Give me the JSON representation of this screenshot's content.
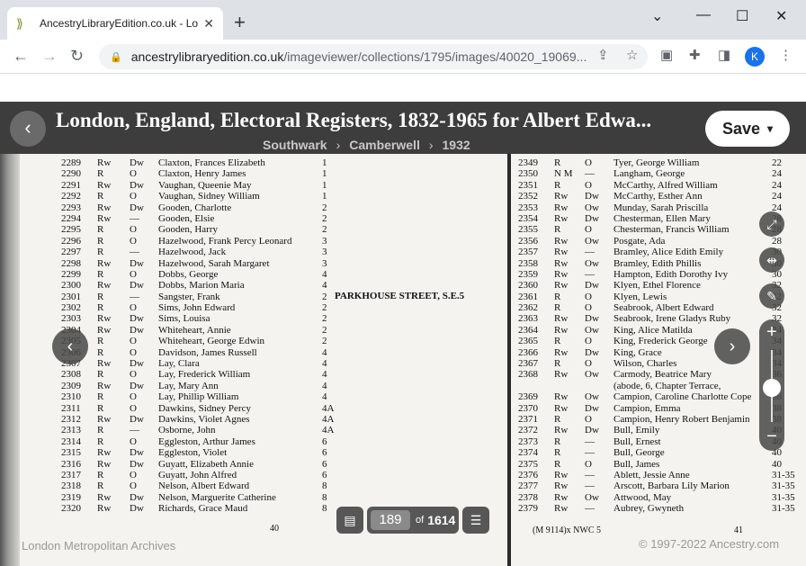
{
  "browser": {
    "tab_title": "AncestryLibraryEdition.co.uk - Lo",
    "url_host": "ancestrylibraryedition.co.uk",
    "url_path": "/imageviewer/collections/1795/images/40020_19069...",
    "profile_initial": "K"
  },
  "viewer": {
    "title": "London, England, Electoral Registers, 1832-1965 for Albert Edwa...",
    "breadcrumb": [
      "Southwark",
      "Camberwell",
      "1932"
    ],
    "save_label": "Save",
    "current_image": "189",
    "of_label": "of",
    "total_images": "1614",
    "footer_left": "London Metropolitan Archives",
    "footer_right": "© 1997-2022 Ancestry.com"
  },
  "document": {
    "street": "PARKHOUSE STREET, S.E.5",
    "left_page_number": "40",
    "right_page_number": "41",
    "right_footer_code": "(M 9114)x  NWC 5",
    "left_rows": [
      {
        "no": "2289",
        "q": "Rw",
        "s": "Dw",
        "name": "Claxton, Frances Elizabeth",
        "addr": "1"
      },
      {
        "no": "2290",
        "q": "R",
        "s": "O",
        "name": "Claxton, Henry James",
        "addr": "1"
      },
      {
        "no": "2291",
        "q": "Rw",
        "s": "Dw",
        "name": "Vaughan, Queenie May",
        "addr": "1"
      },
      {
        "no": "2292",
        "q": "R",
        "s": "O",
        "name": "Vaughan, Sidney William",
        "addr": "1"
      },
      {
        "no": "2293",
        "q": "Rw",
        "s": "Dw",
        "name": "Gooden, Charlotte",
        "addr": "2"
      },
      {
        "no": "2294",
        "q": "Rw",
        "s": "—",
        "name": "Gooden, Elsie",
        "addr": "2"
      },
      {
        "no": "2295",
        "q": "R",
        "s": "O",
        "name": "Gooden, Harry",
        "addr": "2"
      },
      {
        "no": "2296",
        "q": "R",
        "s": "O",
        "name": "Hazelwood, Frank Percy Leonard",
        "addr": "3"
      },
      {
        "no": "2297",
        "q": "R",
        "s": "—",
        "name": "Hazelwood, Jack",
        "addr": "3"
      },
      {
        "no": "2298",
        "q": "Rw",
        "s": "Dw",
        "name": "Hazelwood, Sarah Margaret",
        "addr": "3"
      },
      {
        "no": "2299",
        "q": "R",
        "s": "O",
        "name": "Dobbs, George",
        "addr": "4"
      },
      {
        "no": "2300",
        "q": "Rw",
        "s": "Dw",
        "name": "Dobbs, Marion Maria",
        "addr": "4"
      },
      {
        "no": "2301",
        "q": "R",
        "s": "—",
        "name": "Sangster, Frank",
        "addr": "2"
      },
      {
        "no": "2302",
        "q": "R",
        "s": "O",
        "name": "Sims, John Edward",
        "addr": "2"
      },
      {
        "no": "2303",
        "q": "Rw",
        "s": "Dw",
        "name": "Sims, Louisa",
        "addr": "2"
      },
      {
        "no": "2304",
        "q": "Rw",
        "s": "Dw",
        "name": "Whiteheart, Annie",
        "addr": "2"
      },
      {
        "no": "2305",
        "q": "R",
        "s": "O",
        "name": "Whiteheart, George Edwin",
        "addr": "2"
      },
      {
        "no": "2306",
        "q": "R",
        "s": "O",
        "name": "Davidson, James Russell",
        "addr": "4"
      },
      {
        "no": "2307",
        "q": "Rw",
        "s": "Dw",
        "name": "Lay, Clara",
        "addr": "4"
      },
      {
        "no": "2308",
        "q": "R",
        "s": "O",
        "name": "Lay, Frederick William",
        "addr": "4"
      },
      {
        "no": "2309",
        "q": "Rw",
        "s": "Dw",
        "name": "Lay, Mary Ann",
        "addr": "4"
      },
      {
        "no": "2310",
        "q": "R",
        "s": "O",
        "name": "Lay, Phillip William",
        "addr": "4"
      },
      {
        "no": "2311",
        "q": "R",
        "s": "O",
        "name": "Dawkins, Sidney Percy",
        "addr": "4A"
      },
      {
        "no": "2312",
        "q": "Rw",
        "s": "Dw",
        "name": "Dawkins, Violet Agnes",
        "addr": "4A"
      },
      {
        "no": "2313",
        "q": "R",
        "s": "—",
        "name": "Osborne, John",
        "addr": "4A"
      },
      {
        "no": "2314",
        "q": "R",
        "s": "O",
        "name": "Eggleston, Arthur James",
        "addr": "6"
      },
      {
        "no": "2315",
        "q": "Rw",
        "s": "Dw",
        "name": "Eggleston, Violet",
        "addr": "6"
      },
      {
        "no": "2316",
        "q": "Rw",
        "s": "Dw",
        "name": "Guyatt, Elizabeth Annie",
        "addr": "6"
      },
      {
        "no": "2317",
        "q": "R",
        "s": "O",
        "name": "Guyatt, John Alfred",
        "addr": "6"
      },
      {
        "no": "2318",
        "q": "R",
        "s": "O",
        "name": "Nelson, Albert Edward",
        "addr": "8"
      },
      {
        "no": "2319",
        "q": "Rw",
        "s": "Dw",
        "name": "Nelson, Marguerite Catherine",
        "addr": "8"
      },
      {
        "no": "2320",
        "q": "Rw",
        "s": "Dw",
        "name": "Richards, Grace Maud",
        "addr": "8"
      }
    ],
    "right_rows": [
      {
        "no": "2349",
        "q": "R",
        "s": "O",
        "name": "Tyer, George William",
        "addr": "22"
      },
      {
        "no": "2350",
        "q": "N M",
        "s": "—",
        "name": "Langham, George",
        "addr": "24"
      },
      {
        "no": "2351",
        "q": "R",
        "s": "O",
        "name": "McCarthy, Alfred William",
        "addr": "24"
      },
      {
        "no": "2352",
        "q": "Rw",
        "s": "Dw",
        "name": "McCarthy, Esther Ann",
        "addr": "24"
      },
      {
        "no": "2353",
        "q": "Rw",
        "s": "Ow",
        "name": "Munday, Sarah Priscilla",
        "addr": "24"
      },
      {
        "no": "2354",
        "q": "Rw",
        "s": "Dw",
        "name": "Chesterman, Ellen Mary",
        "addr": "28"
      },
      {
        "no": "2355",
        "q": "R",
        "s": "O",
        "name": "Chesterman, Francis William",
        "addr": "28"
      },
      {
        "no": "2356",
        "q": "Rw",
        "s": "Ow",
        "name": "Posgate, Ada",
        "addr": "28"
      },
      {
        "no": "2357",
        "q": "Rw",
        "s": "—",
        "name": "Bramley, Alice Edith Emily",
        "addr": "30"
      },
      {
        "no": "2358",
        "q": "Rw",
        "s": "Ow",
        "name": "Bramley, Edith Phillis",
        "addr": "30"
      },
      {
        "no": "2359",
        "q": "Rw",
        "s": "—",
        "name": "Hampton, Edith Dorothy Ivy",
        "addr": "30"
      },
      {
        "no": "2360",
        "q": "Rw",
        "s": "Dw",
        "name": "Klyen, Ethel Florence",
        "addr": "32"
      },
      {
        "no": "2361",
        "q": "R",
        "s": "O",
        "name": "Klyen, Lewis",
        "addr": "32"
      },
      {
        "no": "2362",
        "q": "R",
        "s": "O",
        "name": "Seabrook, Albert Edward",
        "addr": "32"
      },
      {
        "no": "2363",
        "q": "Rw",
        "s": "Dw",
        "name": "Seabrook, Irene Gladys Ruby",
        "addr": "32"
      },
      {
        "no": "2364",
        "q": "Rw",
        "s": "Ow",
        "name": "King, Alice Matilda",
        "addr": "34"
      },
      {
        "no": "2365",
        "q": "R",
        "s": "O",
        "name": "King, Frederick George",
        "addr": "34"
      },
      {
        "no": "2366",
        "q": "Rw",
        "s": "Dw",
        "name": "King, Grace",
        "addr": "34"
      },
      {
        "no": "2367",
        "q": "R",
        "s": "O",
        "name": "Wilson, Charles",
        "addr": "34"
      },
      {
        "no": "2368",
        "q": "Rw",
        "s": "Ow",
        "name": "Carmody, Beatrice Mary",
        "addr": "36"
      },
      {
        "no": "",
        "q": "",
        "s": "",
        "name": "(abode, 6, Chapter Terrace,",
        "addr": ""
      },
      {
        "no": "2369",
        "q": "Rw",
        "s": "Ow",
        "name": "Campion, Caroline Charlotte Cope",
        "addr": "38"
      },
      {
        "no": "2370",
        "q": "Rw",
        "s": "Dw",
        "name": "Campion, Emma",
        "addr": "38"
      },
      {
        "no": "2371",
        "q": "R",
        "s": "O",
        "name": "Campion, Henry Robert Benjamin",
        "addr": "38"
      },
      {
        "no": "2372",
        "q": "Rw",
        "s": "Dw",
        "name": "Bull, Emily",
        "addr": "40"
      },
      {
        "no": "2373",
        "q": "R",
        "s": "—",
        "name": "Bull, Ernest",
        "addr": "40"
      },
      {
        "no": "2374",
        "q": "R",
        "s": "—",
        "name": "Bull, George",
        "addr": "40"
      },
      {
        "no": "2375",
        "q": "R",
        "s": "O",
        "name": "Bull, James",
        "addr": "40"
      },
      {
        "no": "2376",
        "q": "Rw",
        "s": "—",
        "name": "Ablett, Jessie Anne",
        "addr": "31-35"
      },
      {
        "no": "2377",
        "q": "Rw",
        "s": "—",
        "name": "Arscott, Barbara Lily Marion",
        "addr": "31-35"
      },
      {
        "no": "2378",
        "q": "Rw",
        "s": "Ow",
        "name": "Attwood, May",
        "addr": "31-35"
      },
      {
        "no": "2379",
        "q": "Rw",
        "s": "—",
        "name": "Aubrey, Gwyneth",
        "addr": "31-35"
      }
    ]
  }
}
